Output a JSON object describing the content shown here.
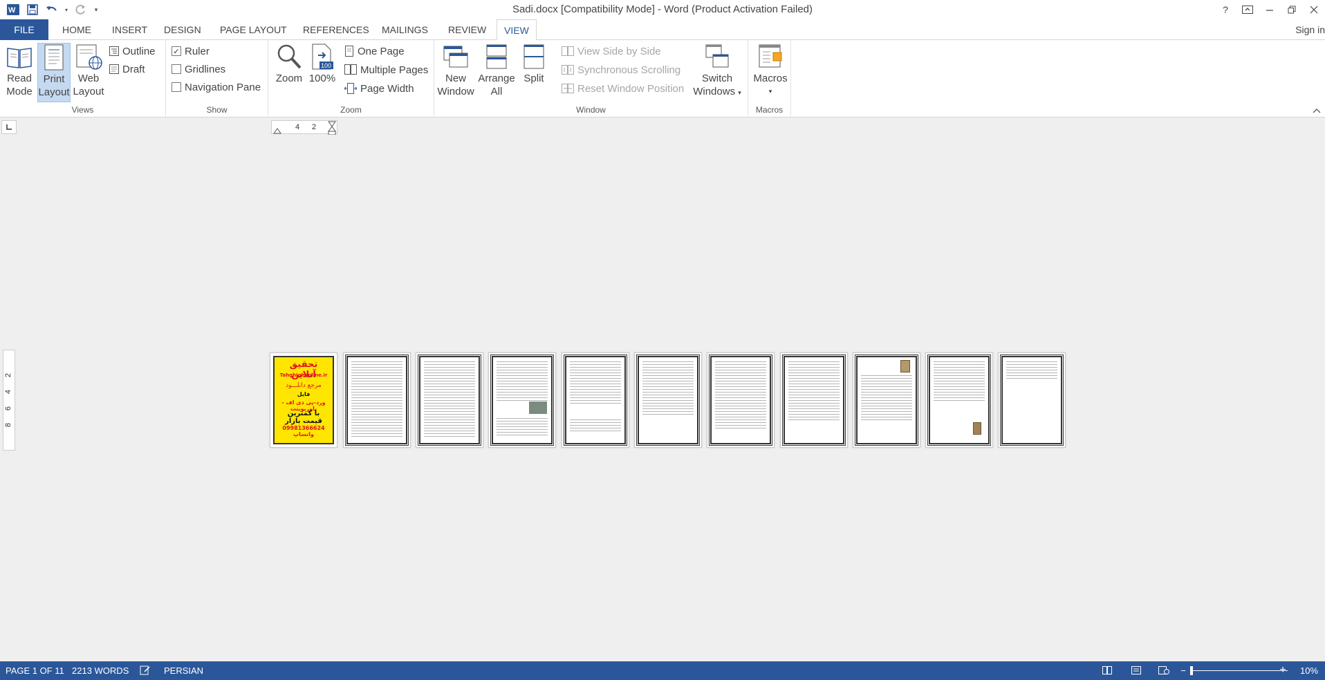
{
  "titlebar": {
    "title": "Sadi.docx [Compatibility Mode] - Word (Product Activation Failed)",
    "help": "?",
    "icons": [
      "word-icon",
      "save-icon",
      "undo-icon",
      "redo-icon",
      "customize-icon"
    ]
  },
  "tabs": {
    "file": "FILE",
    "items": [
      "HOME",
      "INSERT",
      "DESIGN",
      "PAGE LAYOUT",
      "REFERENCES",
      "MAILINGS",
      "REVIEW",
      "VIEW"
    ],
    "active": "VIEW",
    "signin": "Sign in"
  },
  "ribbon": {
    "views": {
      "label": "Views",
      "read_mode": [
        "Read",
        "Mode"
      ],
      "print_layout": [
        "Print",
        "Layout"
      ],
      "web_layout": [
        "Web",
        "Layout"
      ],
      "outline": "Outline",
      "draft": "Draft"
    },
    "show": {
      "label": "Show",
      "ruler": {
        "text": "Ruler",
        "checked": true
      },
      "gridlines": {
        "text": "Gridlines",
        "checked": false
      },
      "navigation_pane": {
        "text": "Navigation Pane",
        "checked": false
      }
    },
    "zoom": {
      "label": "Zoom",
      "zoom": "Zoom",
      "hundred": "100%",
      "hundred_badge": "100",
      "one_page": "One Page",
      "multiple_pages": "Multiple Pages",
      "page_width": "Page Width"
    },
    "window": {
      "label": "Window",
      "new_window": [
        "New",
        "Window"
      ],
      "arrange_all": [
        "Arrange",
        "All"
      ],
      "split": "Split",
      "view_side_by_side": "View Side by Side",
      "synchronous_scrolling": "Synchronous Scrolling",
      "reset_window_position": "Reset Window Position",
      "switch_windows": [
        "Switch",
        "Windows"
      ]
    },
    "macros": {
      "label": "Macros",
      "macros": "Macros"
    }
  },
  "rulers": {
    "horizontal": [
      "4",
      "2"
    ],
    "vertical": [
      "2",
      "4",
      "6",
      "8"
    ]
  },
  "document": {
    "page_count": 11,
    "cover": {
      "line1": "تحقیق آنلاین",
      "line2": "Tahghighonline.ir",
      "line3": "مرجع دانلـــود",
      "line4": "فایل",
      "line5": "ورد-پی دی اف - پاورپوینت",
      "line6": "با کمترین قیمت بازار",
      "line7": "09981366624 واتساپ"
    }
  },
  "statusbar": {
    "page": "PAGE 1 OF 11",
    "words": "2213 WORDS",
    "language": "PERSIAN",
    "zoom_minus": "−",
    "zoom_plus": "+",
    "zoom_level": "10%",
    "zoom_fraction": 0.1
  },
  "colors": {
    "accent": "#2b579a",
    "cover_yellow": "#ffe600",
    "cover_red": "#e0141e"
  }
}
